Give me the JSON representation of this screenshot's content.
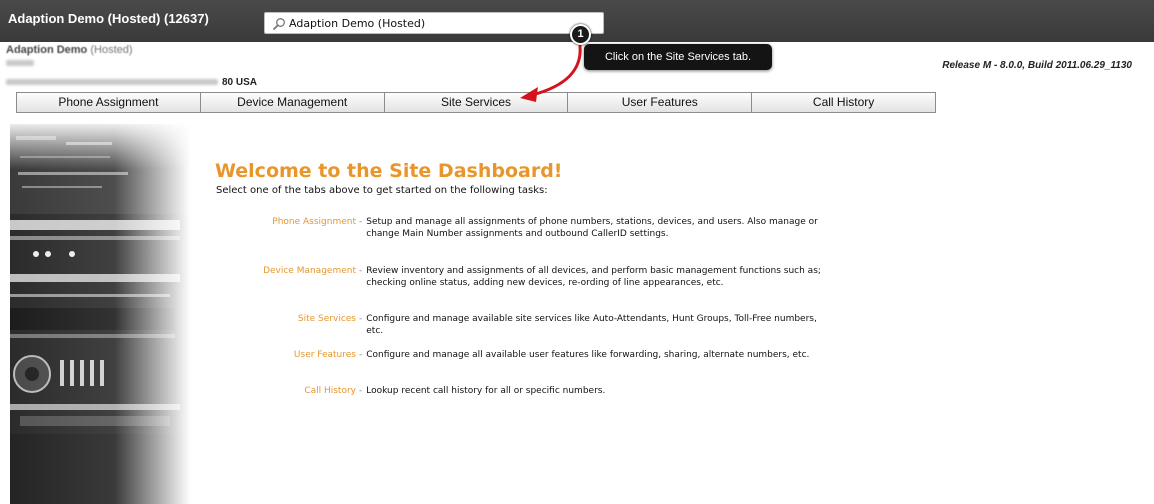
{
  "header": {
    "app_title": "Adaption Demo (Hosted) (12637)",
    "search_value": "Adaption Demo (Hosted)"
  },
  "site": {
    "name": "Adaption Demo",
    "name_suffix": "(Hosted)",
    "country": "80 USA",
    "release": "Release M - 8.0.0, Build 2011.06.29_1130"
  },
  "tabs": [
    {
      "label": "Phone Assignment"
    },
    {
      "label": "Device Management"
    },
    {
      "label": "Site Services"
    },
    {
      "label": "User Features"
    },
    {
      "label": "Call History"
    }
  ],
  "callout": {
    "number": "1",
    "text": "Click on the Site Services tab."
  },
  "welcome": {
    "title": "Welcome to the Site Dashboard!",
    "subtitle": "Select one of the tabs above to get started on the following tasks:",
    "tasks": [
      {
        "label": "Phone Assignment",
        "description": "Setup and manage all assignments of phone numbers, stations, devices, and users.  Also manage or change Main Number assignments and outbound CallerID settings."
      },
      {
        "label": "Device Management",
        "description": "Review inventory and assignments of all devices, and perform basic management functions such as; checking online status, adding new devices, re-ording of line appearances, etc."
      },
      {
        "label": "Site Services",
        "description": "Configure and manage available site services like Auto-Attendants, Hunt Groups, Toll-Free numbers, etc."
      },
      {
        "label": "User Features",
        "description": "Configure and manage all available user features like forwarding, sharing, alternate numbers, etc."
      },
      {
        "label": "Call History",
        "description": "Lookup recent call history for all or specific numbers."
      }
    ]
  },
  "colors": {
    "accent": "#e8962c",
    "topbar": "#3f3f3f",
    "callout_bg": "#141414",
    "arrow": "#d4141c"
  }
}
